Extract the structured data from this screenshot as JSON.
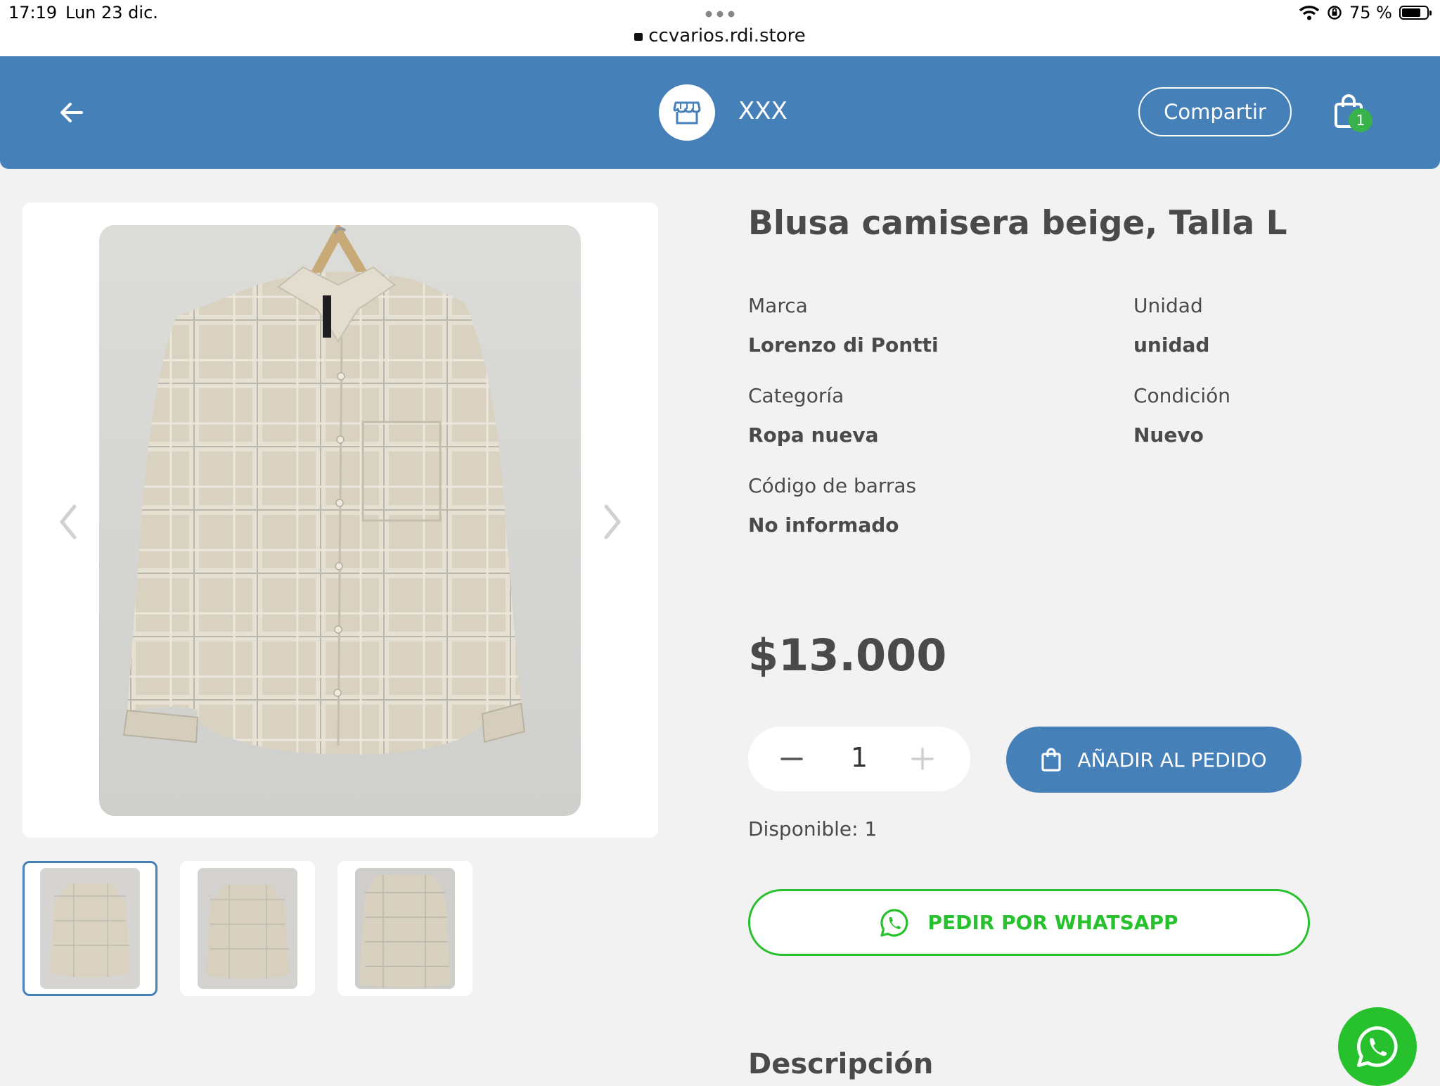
{
  "status_bar": {
    "time": "17:19",
    "date": "Lun 23 dic.",
    "url": "ccvarios.rdi.store",
    "battery": "75 %",
    "battery_level": 0.75
  },
  "header": {
    "store_name": "XXX",
    "share_label": "Compartir",
    "cart_count": "1",
    "color": "#4580b9"
  },
  "product": {
    "title": "Blusa camisera beige, Talla L",
    "specs": [
      {
        "label": "Marca",
        "value": "Lorenzo di Pontti"
      },
      {
        "label": "Unidad",
        "value": "unidad"
      },
      {
        "label": "Categoría",
        "value": "Ropa nueva"
      },
      {
        "label": "Condición",
        "value": "Nuevo"
      },
      {
        "label": "Código de barras",
        "value": "No informado"
      }
    ],
    "price": "$13.000",
    "quantity": "1",
    "add_label": "AÑADIR AL PEDIDO",
    "available": "Disponible: 1",
    "whatsapp_label": "PEDIR POR WHATSAPP",
    "description_heading": "Descripción"
  },
  "gallery": {
    "thumbnails": 3,
    "active_index": 0
  },
  "icons": {
    "back": "arrow-left-icon",
    "store": "store-icon",
    "cart": "shopping-bag-icon",
    "whatsapp": "whatsapp-icon"
  },
  "colors": {
    "primary": "#4580b9",
    "whatsapp": "#28c12e",
    "badge": "#38b24a"
  }
}
